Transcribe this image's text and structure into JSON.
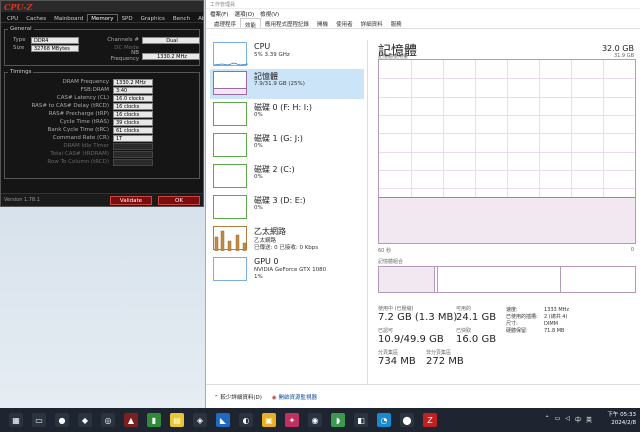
{
  "cpuz": {
    "title": "CPU-Z",
    "tabs": [
      "CPU",
      "Caches",
      "Mainboard",
      "Memory",
      "SPD",
      "Graphics",
      "Bench",
      "About"
    ],
    "general_legend": "General",
    "type_label": "Type",
    "type_value": "DDR4",
    "size_label": "Size",
    "size_value": "32768 MBytes",
    "channels_label": "Channels #",
    "channels_value": "Dual",
    "dc_mode_label": "DC Mode",
    "dc_mode_value": "",
    "nb_label": "NB Frequency",
    "nb_value": "1330.2 MHz",
    "timings_legend": "Timings",
    "timings": [
      {
        "label": "DRAM Frequency",
        "value": "1330.2 MHz"
      },
      {
        "label": "FSB:DRAM",
        "value": "3:40"
      },
      {
        "label": "CAS# Latency (CL)",
        "value": "16.0 clocks"
      },
      {
        "label": "RAS# to CAS# Delay (tRCD)",
        "value": "16 clocks"
      },
      {
        "label": "RAS# Precharge (tRP)",
        "value": "16 clocks"
      },
      {
        "label": "Cycle Time (tRAS)",
        "value": "39 clocks"
      },
      {
        "label": "Bank Cycle Time (tRC)",
        "value": "61 clocks"
      },
      {
        "label": "Command Rate (CR)",
        "value": "1T"
      },
      {
        "label": "DRAM Idle Timer",
        "value": ""
      },
      {
        "label": "Total CAS# (tRDRAM)",
        "value": ""
      },
      {
        "label": "Row To Column (tRCD)",
        "value": ""
      }
    ],
    "version": "Version 1.78.1",
    "validate": "Validate",
    "ok": "OK"
  },
  "tm": {
    "title": "工作管理員",
    "menu": [
      "檔案(F)",
      "選項(O)",
      "檢視(V)"
    ],
    "tabs": [
      "處理程序",
      "效能",
      "應用程式歷程記錄",
      "開機",
      "使用者",
      "詳細資料",
      "服務"
    ],
    "active_tab": 1,
    "items": [
      {
        "t1": "CPU",
        "t2": "5% 3.39 GHz",
        "t3": ""
      },
      {
        "t1": "記憶體",
        "t2": "7.9/31.9 GB (25%)",
        "t3": ""
      },
      {
        "t1": "磁碟 0 (F: H: I:)",
        "t2": "0%",
        "t3": ""
      },
      {
        "t1": "磁碟 1 (G: J:)",
        "t2": "0%",
        "t3": ""
      },
      {
        "t1": "磁碟 2 (C:)",
        "t2": "0%",
        "t3": ""
      },
      {
        "t1": "磁碟 3 (D: E:)",
        "t2": "0%",
        "t3": ""
      },
      {
        "t1": "乙太網路",
        "t2": "乙太網路",
        "t3": "已傳送: 0 已接收: 0 Kbps"
      },
      {
        "t1": "GPU 0",
        "t2": "NVIDIA GeForce GTX 1080",
        "t3": "1%"
      }
    ],
    "heading": "記憶體",
    "capacity": "32.0 GB",
    "usage_label": "記憶體使用量",
    "usage_max": "31.9 GB",
    "x_left": "60 秒",
    "x_right": "0",
    "composition_label": "記憶體組合",
    "usage_fraction": 0.25,
    "stats": {
      "in_use_label": "使用中 (已壓縮)",
      "in_use_value": "7.2 GB (1.3 MB)",
      "available_label": "可用的",
      "available_value": "24.1 GB",
      "committed_label": "已認可",
      "committed_value": "10.9/49.9 GB",
      "cached_label": "已快取",
      "cached_value": "16.0 GB",
      "paged_label": "分頁集區",
      "paged_value": "734 MB",
      "nonpaged_label": "非分頁集區",
      "nonpaged_value": "272 MB"
    },
    "details": [
      {
        "k": "速度:",
        "v": "1333 MHz"
      },
      {
        "k": "已使用的插槽:",
        "v": "2 (總共 4)"
      },
      {
        "k": "尺寸:",
        "v": "DIMM"
      },
      {
        "k": "硬體保留:",
        "v": "71.8 MB"
      }
    ],
    "fewer": "較少詳細資料(D)",
    "monitor": "開啟資源監視器"
  },
  "taskbar": {
    "time": "下午 05:33",
    "date": "2024/2/8",
    "lang": "中",
    "ime": "英"
  }
}
